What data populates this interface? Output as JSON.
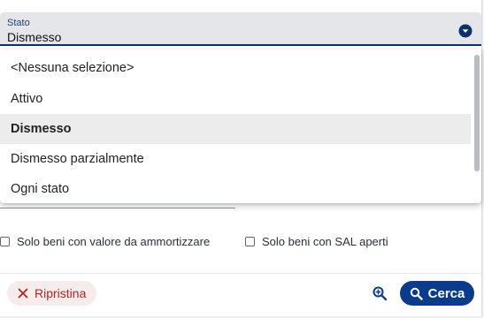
{
  "filter": {
    "label": "Stato",
    "value": "Dismesso"
  },
  "dropdown": {
    "options": [
      "<Nessuna selezione>",
      "Attivo",
      "Dismesso",
      "Dismesso parzialmente",
      "Ogni stato"
    ],
    "selected_index": 2
  },
  "checkboxes": {
    "ammortizzare": "Solo beni con valore da ammortizzare",
    "sal": "Solo beni con SAL aperti"
  },
  "footer": {
    "reset_label": "Ripristina",
    "search_label": "Cerca"
  },
  "colors": {
    "primary": "#0b3c8c",
    "danger": "#b3261e"
  }
}
